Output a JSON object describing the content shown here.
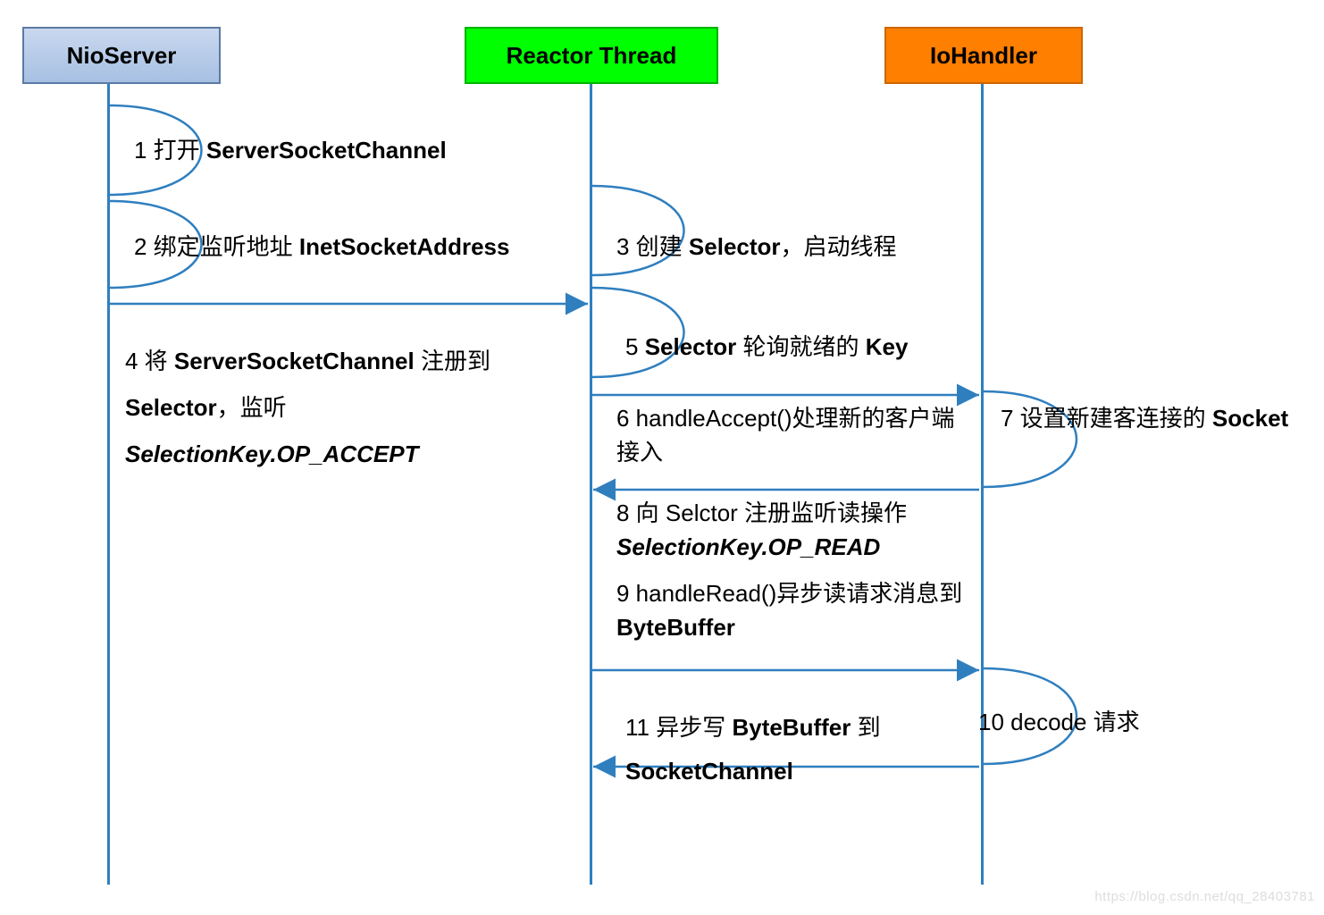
{
  "lanes": {
    "nioServer": "NioServer",
    "reactor": "Reactor Thread",
    "ioHandler": "IoHandler"
  },
  "steps": {
    "s1": "1 打开 <b>ServerSocketChannel</b>",
    "s2": "2 绑定监听地址 <b>InetSocketAddress</b>",
    "s3": "3 创建 <b>Selector</b>，启动线程",
    "s4": "4 将 <b>ServerSocketChannel</b> 注册到 <b>Selector</b>，监听 <i>SelectionKey.OP_ACCEPT</i>",
    "s5": "5 <b>Selector</b> 轮询就绪的 <b>Key</b>",
    "s6": "6 handleAccept()处理新的客户端接入",
    "s7": "7 设置新建客连接的 <b>Socket</b>",
    "s8": "8 向 Selctor 注册监听读操作 <i>SelectionKey.OP_READ</i>",
    "s9": "9 handleRead()异步读请求消息到 <b>ByteBuffer</b>",
    "s10": "10 decode 请求",
    "s11": "11 异步写 <b>ByteBuffer</b> 到 <b>SocketChannel</b>"
  },
  "watermark": "https://blog.csdn.net/qq_28403781"
}
